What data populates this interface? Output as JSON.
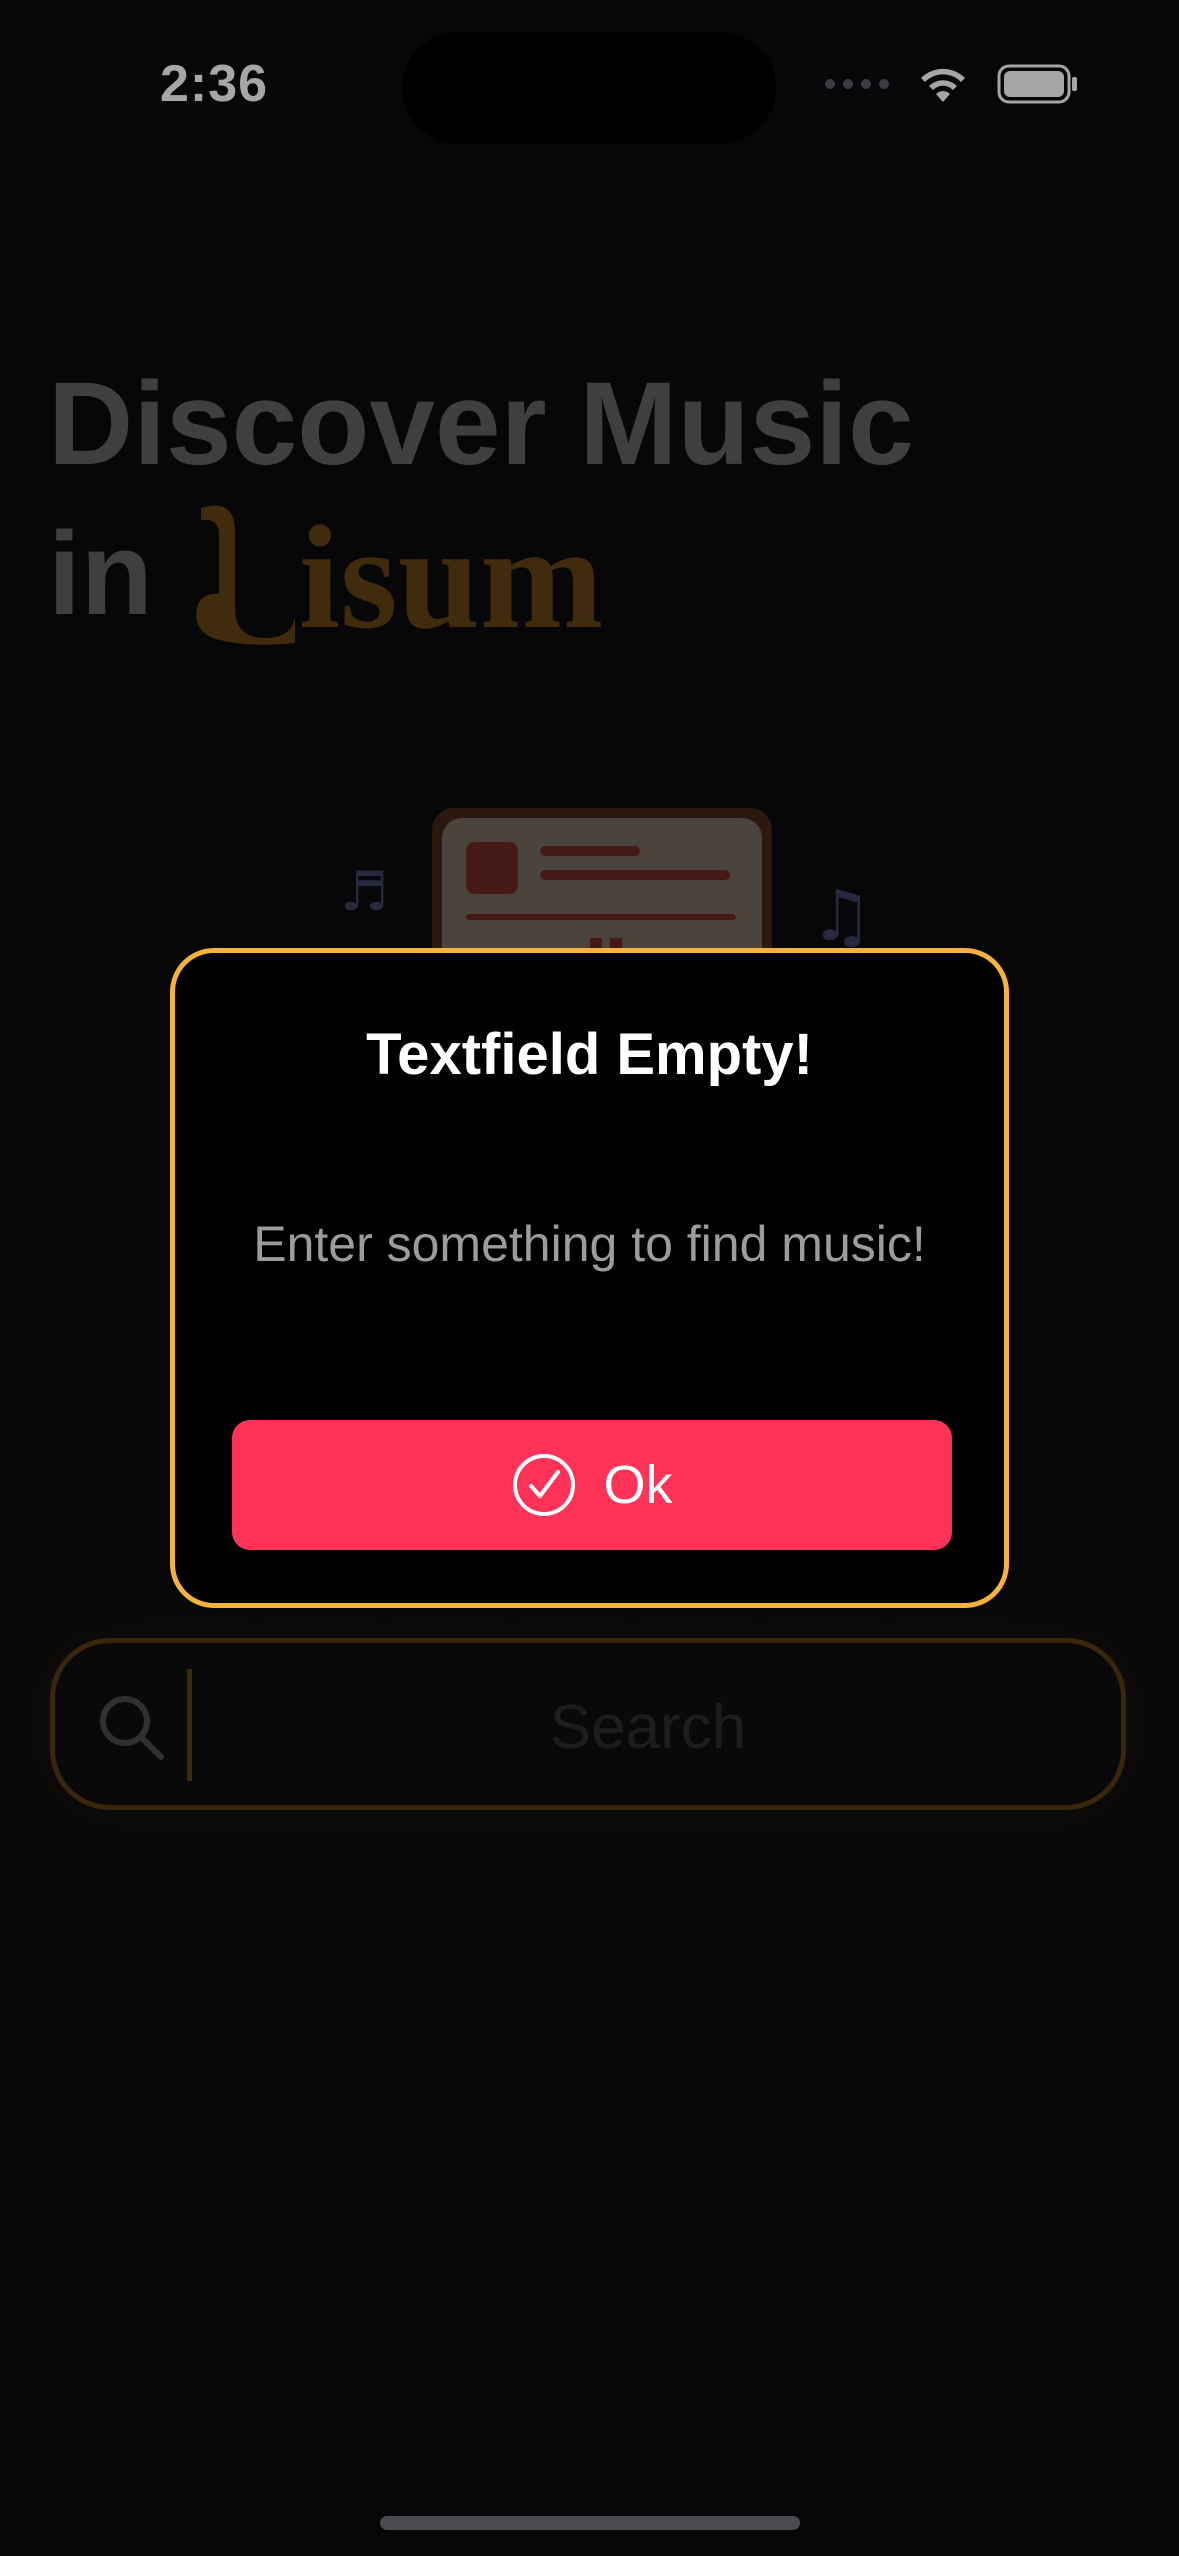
{
  "status_bar": {
    "time": "2:36",
    "icons": [
      "signal-dots-icon",
      "wifi-icon",
      "battery-icon"
    ]
  },
  "hero": {
    "line1": "Discover Music",
    "line2_prefix": "in",
    "brand_name": "isum"
  },
  "search": {
    "placeholder": "Search",
    "value": "",
    "icon": "search-icon"
  },
  "alert": {
    "title": "Textfield Empty!",
    "message": "Enter something to find music!",
    "button_label": "Ok",
    "button_icon": "checkmark-circle-icon"
  },
  "colors": {
    "background": "#0b0c0e",
    "brand": "#d48a1e",
    "alert_border": "#f6b23a",
    "button": "#ff3358",
    "search_border": "#b8781a"
  }
}
